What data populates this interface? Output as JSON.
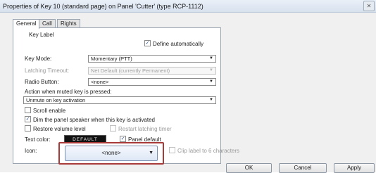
{
  "window": {
    "title": "Properties of Key 10 (standard page) on Panel 'Cutter' (type RCP-1112)",
    "close_label": "✕"
  },
  "tabs": [
    {
      "label": "General",
      "active": true
    },
    {
      "label": "Call",
      "active": false
    },
    {
      "label": "Rights",
      "active": false
    }
  ],
  "general": {
    "key_label_heading": "Key Label",
    "define_auto_label": "Define automatically",
    "define_auto_checked": true,
    "key_mode_label": "Key Mode:",
    "key_mode_value": "Momentary (PTT)",
    "latching_timeout_label": "Latching Timeout:",
    "latching_timeout_value": "Net Default (currently Permanent)",
    "radio_button_label": "Radio Button:",
    "radio_button_value": "<none>",
    "action_muted_label": "Action when muted key is pressed:",
    "action_muted_value": "Unmute on key activation",
    "scroll_enable_label": "Scroll enable",
    "scroll_enable_checked": false,
    "dim_panel_label": "Dim the panel speaker when this key is activated",
    "dim_panel_checked": true,
    "restore_volume_label": "Restore volume level",
    "restore_volume_checked": false,
    "restart_latching_label": "Restart latching timer",
    "restart_latching_checked": false,
    "text_color_label": "Text color:",
    "text_color_value": "DEFAULT",
    "panel_default_label": "Panel default",
    "panel_default_checked": true,
    "icon_label": "Icon:",
    "icon_value": "<none>",
    "clip_label": "Clip label to 6 characters",
    "clip_checked": false
  },
  "buttons": {
    "ok": "OK",
    "cancel": "Cancel",
    "apply": "Apply"
  },
  "colors": {
    "highlight": "#a83a3a",
    "text_color_swatch": "#121212",
    "check": "#2a4a8a"
  },
  "icons": {
    "close": "close-icon",
    "dropdown": "chevron-down-icon",
    "check": "checkmark-icon"
  }
}
